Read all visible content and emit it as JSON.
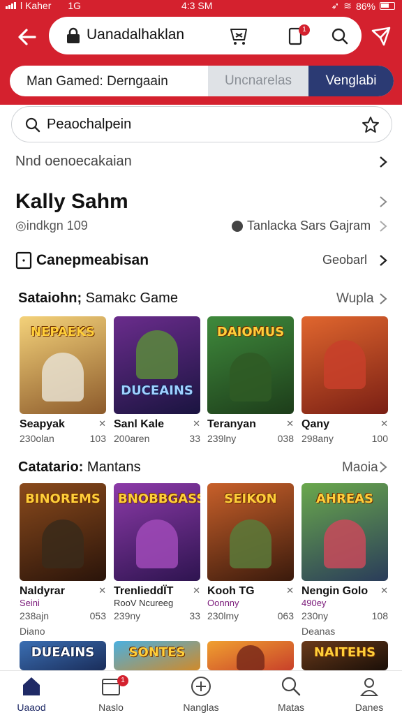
{
  "status": {
    "carrier": "l Kaher",
    "network": "1G",
    "time": "4:3 SM",
    "battery": "86%"
  },
  "header": {
    "url": "Uanadalhaklan",
    "cart_badge": "1",
    "tab_main": "Man Gamed: Derngaain",
    "tab_mid": "Uncnarelas",
    "tab_active": "Venglabi"
  },
  "search": {
    "value": "Peaochalpein"
  },
  "row_sub": "Nnd oenoecakaian",
  "profile": {
    "name": "Kally Sahm",
    "handle": "indkgn 109",
    "link": "Tanlacka Sars Gajram"
  },
  "section_a": {
    "label": "Canepmeabisan",
    "right": "Geobarl"
  },
  "section1": {
    "title_bold": "Sataiohn;",
    "title_rest": " Samakc Game",
    "link": "Wupla",
    "cards": [
      {
        "art": "NEPAEKS",
        "name": "Seapyak",
        "meta_left": "230olan",
        "meta_right": "103",
        "color1": "#f4d27a",
        "color2": "#8c5a2b"
      },
      {
        "art": "DUCEAINS",
        "name": "Sanl Kale",
        "meta_left": "200aren",
        "meta_right": "33",
        "color1": "#6a2c8c",
        "color2": "#1a1440"
      },
      {
        "art": "DAIOMUS",
        "name": "Teranyan",
        "meta_left": "239lny",
        "meta_right": "038",
        "color1": "#3f8a3c",
        "color2": "#1d3d1a"
      },
      {
        "art": "",
        "name": "Qany",
        "meta_left": "298any",
        "meta_right": "100",
        "color1": "#e0662e",
        "color2": "#7a1f14"
      }
    ]
  },
  "section2": {
    "title_bold": "Catatario:",
    "title_rest": " Mantans",
    "link": "Maoia",
    "cards": [
      {
        "art": "BINOREMS",
        "name": "Naldyrar",
        "sub": "Seini",
        "meta_left": "238ajn",
        "meta_right": "053",
        "foot": "Diano",
        "color1": "#8a4a1c",
        "color2": "#2a140a"
      },
      {
        "art": "BNOBBGASS",
        "name": "TrenlieddÏT",
        "sub": "RooV Ncureeg",
        "meta_left": "239ny",
        "meta_right": "33",
        "foot": "",
        "color1": "#8c3aa8",
        "color2": "#2e1450"
      },
      {
        "art": "SEIKON",
        "name": "Kooh TG",
        "sub": "Oonnny",
        "meta_left": "230lmy",
        "meta_right": "063",
        "foot": "",
        "color1": "#c8602a",
        "color2": "#3a1a0c"
      },
      {
        "art": "AHREAS",
        "name": "Nengin Golo",
        "sub": "490ey",
        "meta_left": "230ny",
        "meta_right": "108",
        "foot": "Deanas",
        "color1": "#6aa84c",
        "color2": "#2a3c5a"
      }
    ]
  },
  "section3": {
    "cards": [
      {
        "art": "DUEAINS",
        "color1": "#3b6fb3",
        "color2": "#1a2d5a"
      },
      {
        "art": "SONTES",
        "color1": "#4ab0e0",
        "color2": "#d08a2a"
      },
      {
        "art": "",
        "color1": "#f0a030",
        "color2": "#c8402a"
      },
      {
        "art": "NAITEHS",
        "color1": "#6a3a1a",
        "color2": "#1a0f08"
      }
    ]
  },
  "nav": [
    {
      "label": "Uaaod",
      "icon": "home-icon"
    },
    {
      "label": "Naslo",
      "icon": "calendar-icon",
      "badge": "1"
    },
    {
      "label": "Nanglas",
      "icon": "plus-circle-icon"
    },
    {
      "label": "Matas",
      "icon": "search-icon"
    },
    {
      "label": "Danes",
      "icon": "person-icon"
    }
  ],
  "colors": {
    "brand_red": "#d4212e",
    "navy": "#2b3a73"
  }
}
